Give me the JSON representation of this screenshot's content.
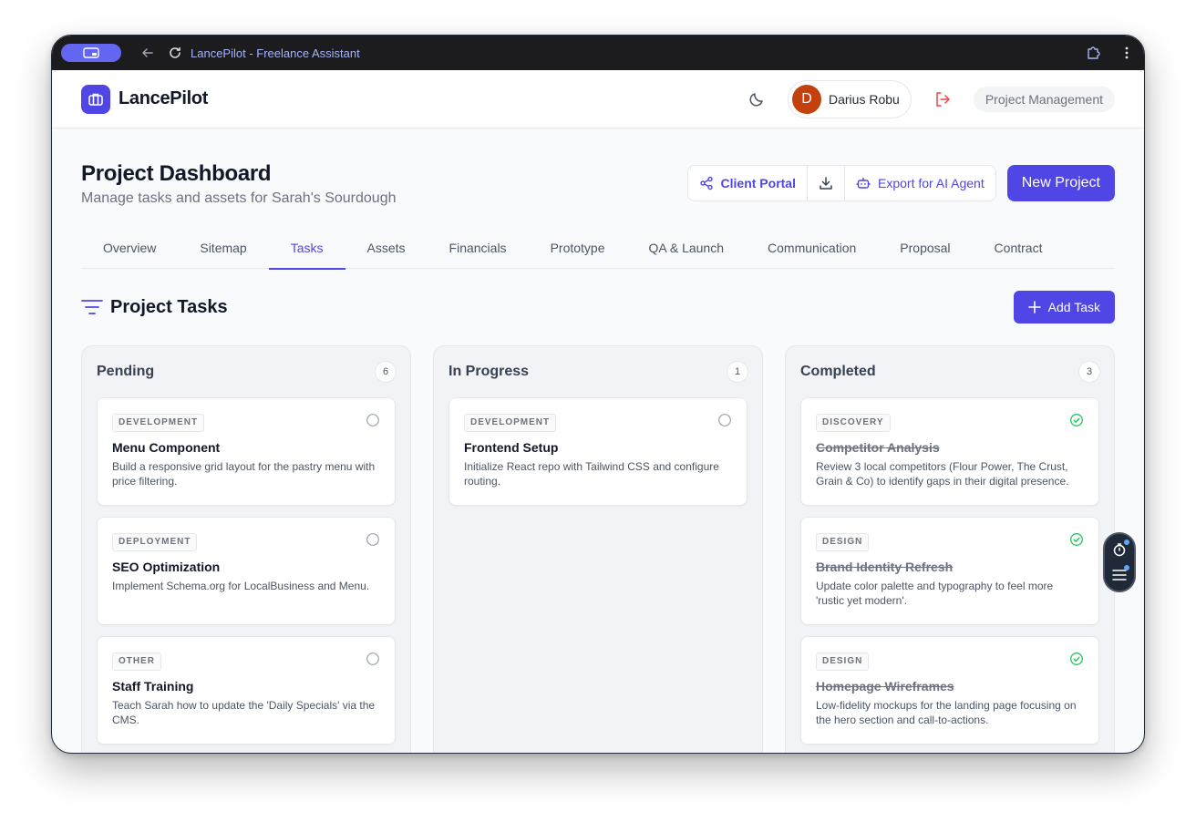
{
  "browser": {
    "title": "LancePilot - Freelance Assistant"
  },
  "header": {
    "brand": "LancePilot",
    "user_initial": "D",
    "user_name": "Darius Robu",
    "project_chip": "Project Management"
  },
  "page": {
    "title": "Project Dashboard",
    "subtitle": "Manage tasks and assets for Sarah's Sourdough",
    "client_portal": "Client Portal",
    "export_ai": "Export for AI Agent",
    "new_project": "New Project"
  },
  "tabs": [
    {
      "label": "Overview"
    },
    {
      "label": "Sitemap"
    },
    {
      "label": "Tasks",
      "active": true
    },
    {
      "label": "Assets"
    },
    {
      "label": "Financials"
    },
    {
      "label": "Prototype"
    },
    {
      "label": "QA & Launch"
    },
    {
      "label": "Communication"
    },
    {
      "label": "Proposal"
    },
    {
      "label": "Contract"
    }
  ],
  "section": {
    "title": "Project Tasks",
    "add_task": "Add Task"
  },
  "columns": [
    {
      "title": "Pending",
      "count": "6",
      "cards": [
        {
          "tag": "DEVELOPMENT",
          "title": "Menu Component",
          "desc": "Build a responsive grid layout for the pastry menu with price filtering.",
          "done": false
        },
        {
          "tag": "DEPLOYMENT",
          "title": "SEO Optimization",
          "desc": "Implement Schema.org for LocalBusiness and Menu.",
          "done": false
        },
        {
          "tag": "OTHER",
          "title": "Staff Training",
          "desc": "Teach Sarah how to update the 'Daily Specials' via the CMS.",
          "done": false
        }
      ]
    },
    {
      "title": "In Progress",
      "count": "1",
      "cards": [
        {
          "tag": "DEVELOPMENT",
          "title": "Frontend Setup",
          "desc": "Initialize React repo with Tailwind CSS and configure routing.",
          "done": false
        }
      ]
    },
    {
      "title": "Completed",
      "count": "3",
      "cards": [
        {
          "tag": "DISCOVERY",
          "title": "Competitor Analysis",
          "desc": "Review 3 local competitors (Flour Power, The Crust, Grain & Co) to identify gaps in their digital presence.",
          "done": true
        },
        {
          "tag": "DESIGN",
          "title": "Brand Identity Refresh",
          "desc": "Update color palette and typography to feel more 'rustic yet modern'.",
          "done": true
        },
        {
          "tag": "DESIGN",
          "title": "Homepage Wireframes",
          "desc": "Low-fidelity mockups for the landing page focusing on the hero section and call-to-actions.",
          "done": true
        }
      ]
    }
  ],
  "colors": {
    "accent": "#4f46e5",
    "done_check": "#22c55e",
    "logout": "#ef4444",
    "avatar": "#c2410c"
  },
  "icons": {
    "logo": "briefcase-icon",
    "theme": "moon-icon",
    "logout": "logout-icon",
    "share": "share-icon",
    "download": "download-icon",
    "bot": "robot-icon",
    "filter": "filter-icon",
    "plus": "plus-icon",
    "pending": "circle-icon",
    "done": "check-circle-icon"
  }
}
